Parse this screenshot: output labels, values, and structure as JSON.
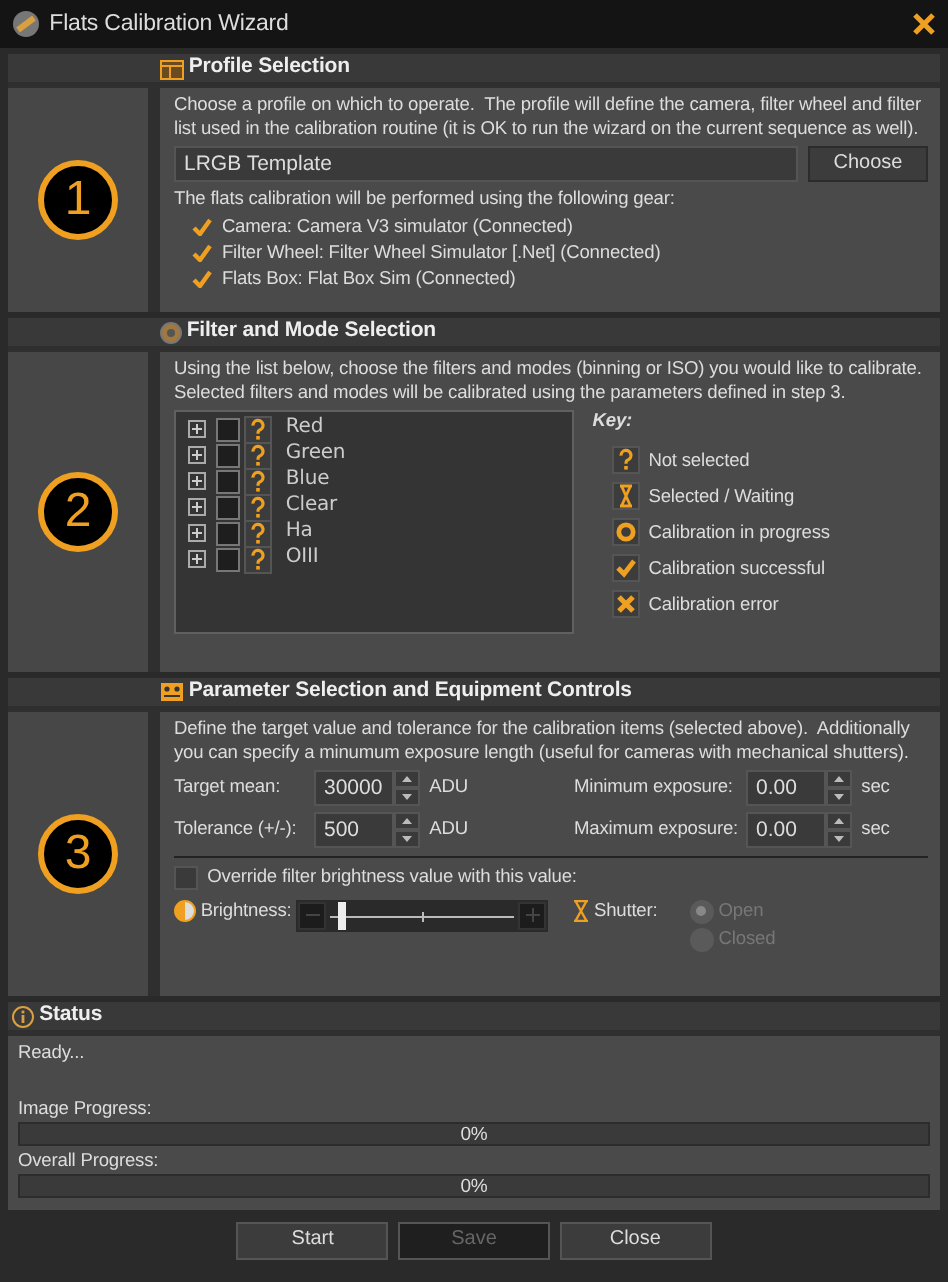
{
  "window": {
    "title": "Flats Calibration Wizard"
  },
  "profile_section": {
    "step": "1",
    "title": "Profile Selection",
    "description": "Choose a profile on which to operate.  The profile will define the camera, filter wheel and filter list used in the calibration routine (it is OK to run the wizard on the current sequence as well).",
    "profile": {
      "value": "LRGB Template"
    },
    "choose_button": "Choose",
    "gear_intro": "The flats calibration will be performed using the following gear:",
    "gear": [
      {
        "label": "Camera: Camera V3 simulator (Connected)"
      },
      {
        "label": "Filter Wheel: Filter Wheel Simulator [.Net] (Connected)"
      },
      {
        "label": "Flats Box: Flat Box Sim (Connected)"
      }
    ]
  },
  "filter_section": {
    "step": "2",
    "title": "Filter and Mode Selection",
    "description": "Using the list below, choose the filters and modes (binning or ISO) you would like to calibrate. Selected filters and modes will be calibrated using the parameters defined in step 3.",
    "filters": [
      {
        "label": "Red",
        "checked": false,
        "kind": "not_selected"
      },
      {
        "label": "Green",
        "checked": false,
        "kind": "not_selected"
      },
      {
        "label": "Blue",
        "checked": false,
        "kind": "not_selected"
      },
      {
        "label": "Clear",
        "checked": false,
        "kind": "not_selected"
      },
      {
        "label": "Ha",
        "checked": false,
        "kind": "not_selected"
      },
      {
        "label": "OIII",
        "checked": false,
        "kind": "not_selected"
      }
    ],
    "key_title": "Key:",
    "key": [
      {
        "kind": "not_selected",
        "label": "Not selected"
      },
      {
        "kind": "waiting",
        "label": "Selected / Waiting"
      },
      {
        "kind": "in_progress",
        "label": "Calibration in progress"
      },
      {
        "kind": "success",
        "label": "Calibration successful"
      },
      {
        "kind": "error",
        "label": "Calibration error"
      }
    ]
  },
  "parameter_section": {
    "step": "3",
    "title": "Parameter Selection and Equipment Controls",
    "description": "Define the target value and tolerance for the calibration items (selected above).  Additionally you can specify a minumum exposure length (useful for cameras with mechanical shutters).",
    "fields": [
      {
        "label": "Target mean:",
        "value": "30000",
        "unit": "ADU"
      },
      {
        "label": "Minimum exposure:",
        "value": "0.00",
        "unit": "sec"
      },
      {
        "label": "Tolerance (+/-):",
        "value": "500",
        "unit": "ADU"
      },
      {
        "label": "Maximum exposure:",
        "value": "0.00",
        "unit": "sec"
      }
    ],
    "override": {
      "label": "Override filter brightness value with this value:",
      "checked": false
    },
    "brightness": {
      "label": "Brightness:",
      "level": 0.08
    },
    "shutter": {
      "label": "Shutter:",
      "options": [
        {
          "label": "Open",
          "selected": true,
          "disabled": true
        },
        {
          "label": "Closed",
          "selected": false,
          "disabled": true
        }
      ]
    }
  },
  "status": {
    "title": "Status",
    "message": "Ready...",
    "progress": [
      {
        "label": "Image Progress:",
        "level": 0,
        "reading": "0%"
      },
      {
        "label": "Overall Progress:",
        "level": 0,
        "reading": "0%"
      }
    ]
  },
  "buttons": [
    {
      "label": "Start",
      "disabled": false
    },
    {
      "label": "Save",
      "disabled": true
    },
    {
      "label": "Close",
      "disabled": false
    }
  ]
}
